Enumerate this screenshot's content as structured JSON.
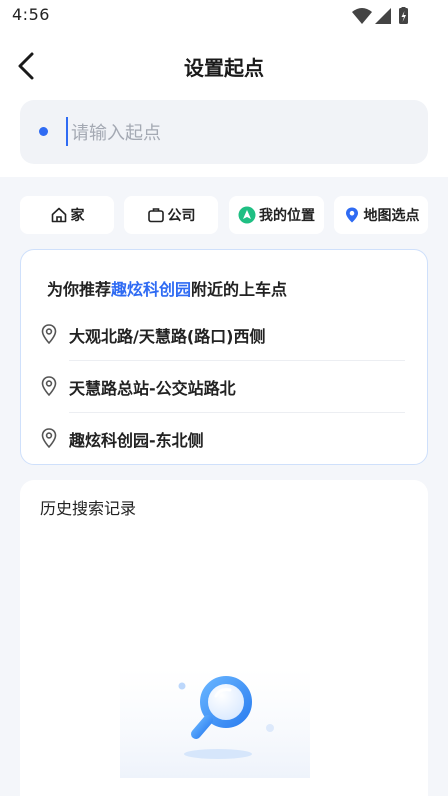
{
  "status_bar": {
    "time": "4:56",
    "icons": [
      "wifi-icon",
      "signal-icon",
      "battery-icon"
    ]
  },
  "header": {
    "title": "设置起点",
    "back_icon": "chevron-left-icon"
  },
  "search": {
    "placeholder": "请输入起点",
    "value": "",
    "dot_color": "#2f6bf3"
  },
  "quick_options": [
    {
      "label": "家",
      "icon": "home-icon"
    },
    {
      "label": "公司",
      "icon": "briefcase-icon"
    },
    {
      "label": "我的位置",
      "icon": "navigation-arrow-icon"
    },
    {
      "label": "地图选点",
      "icon": "map-pin-icon"
    }
  ],
  "recommend": {
    "prefix": "为你推荐",
    "place": "趣炫科创园",
    "suffix": "附近的上车点",
    "items": [
      {
        "label": "大观北路/天慧路(路口)西侧",
        "icon": "location-pin-icon"
      },
      {
        "label": "天慧路总站-公交站路北",
        "icon": "location-pin-icon"
      },
      {
        "label": "趣炫科创园-东北侧",
        "icon": "location-pin-icon"
      }
    ]
  },
  "history": {
    "title": "历史搜索记录",
    "empty_icon": "magnifier-empty-icon"
  },
  "colors": {
    "accent": "#2f6bf3",
    "page_bg": "#f4f6fa",
    "card_border": "#cfe0fb",
    "my_location_green": "#1fbf83"
  }
}
